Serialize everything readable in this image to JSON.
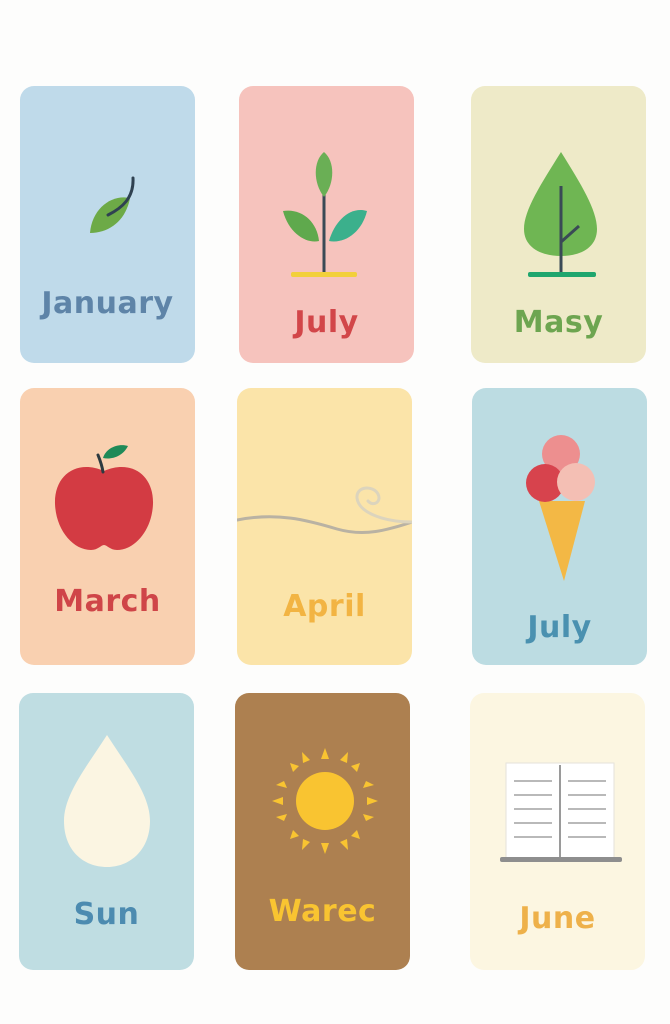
{
  "cards": [
    {
      "label": "January",
      "icon": "leaf-icon",
      "bg": "#bfdaea",
      "text_color": "#5e84a8"
    },
    {
      "label": "July",
      "icon": "sprout-icon",
      "bg": "#f6c3bd",
      "text_color": "#d24649"
    },
    {
      "label": "Masy",
      "icon": "tree-icon",
      "bg": "#eeeac8",
      "text_color": "#6da550"
    },
    {
      "label": "March",
      "icon": "apple-icon",
      "bg": "#f9d0b0",
      "text_color": "#cf4548"
    },
    {
      "label": "April",
      "icon": "wind-icon",
      "bg": "#fbe4a9",
      "text_color": "#f2b443"
    },
    {
      "label": "July",
      "icon": "ice-cream-icon",
      "bg": "#bcdce2",
      "text_color": "#4a91b0"
    },
    {
      "label": "Sun",
      "icon": "water-drop-icon",
      "bg": "#bfdde2",
      "text_color": "#4c8bb0"
    },
    {
      "label": "Warec",
      "icon": "sun-icon",
      "bg": "#ad8050",
      "text_color": "#f9c431"
    },
    {
      "label": "June",
      "icon": "book-icon",
      "bg": "#fcf6e1",
      "text_color": "#eeb14a"
    }
  ]
}
